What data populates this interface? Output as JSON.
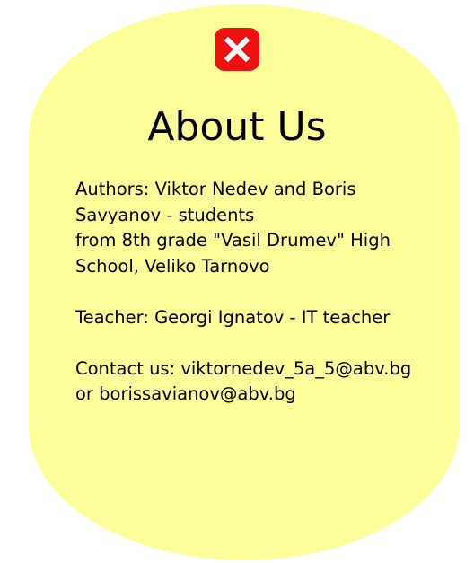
{
  "dialog": {
    "title": "About Us",
    "close_icon": "close-x-icon",
    "close_color": "#ee1111",
    "background_color": "#fdfd9a",
    "authors_line1": "Authors: Viktor Nedev and Boris",
    "authors_line2": "Savyanov - students",
    "authors_line3": "from 8th grade \"Vasil Drumev\" High",
    "authors_line4": "School, Veliko Tarnovo",
    "teacher_line": "Teacher: Georgi Ignatov - IT teacher",
    "contact_line1": "Contact us: viktornedev_5a_5@abv.bg",
    "contact_line2": "or borissavianov@abv.bg"
  }
}
